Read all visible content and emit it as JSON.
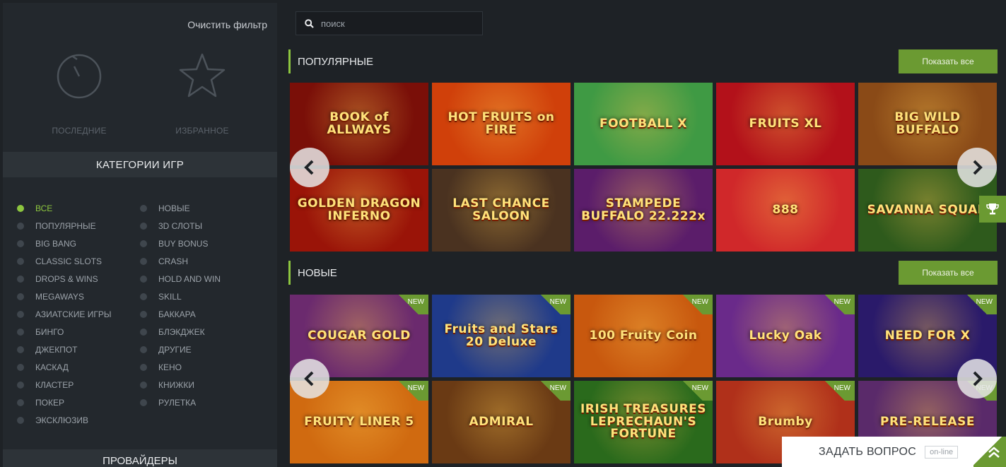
{
  "sidebar": {
    "clear_filter": "Очистить фильтр",
    "quick": {
      "recent": "ПОСЛЕДНИЕ",
      "favorites": "ИЗБРАННОЕ"
    },
    "categories_title": "КАТЕГОРИИ ИГР",
    "categories_left": [
      "ВСЕ",
      "ПОПУЛЯРНЫЕ",
      "BIG BANG",
      "CLASSIC SLOTS",
      "DROPS & WINS",
      "MEGAWAYS",
      "АЗИАТСКИЕ ИГРЫ",
      "БИНГО",
      "ДЖЕКПОТ",
      "КАСКАД",
      "КЛАСТЕР",
      "ПОКЕР",
      "ЭКСКЛЮЗИВ"
    ],
    "categories_right": [
      "НОВЫЕ",
      "3D СЛОТЫ",
      "BUY BONUS",
      "CRASH",
      "HOLD AND WIN",
      "SKILL",
      "БАККАРА",
      "БЛЭКДЖЕК",
      "ДРУГИЕ",
      "КЕНО",
      "КНИЖКИ",
      "РУЛЕТКА"
    ],
    "active_category": "ВСЕ",
    "providers_title": "ПРОВАЙДЕРЫ"
  },
  "search": {
    "placeholder": "поиск"
  },
  "popular": {
    "title": "ПОПУЛЯРНЫЕ",
    "show_all": "Показать все",
    "games": [
      {
        "name": "BOOK of ALLWAYS",
        "bg": "#7a0f08"
      },
      {
        "name": "HOT FRUITS on FIRE",
        "bg": "#d0400a"
      },
      {
        "name": "FOOTBALL X",
        "bg": "#3f9a44"
      },
      {
        "name": "FRUITS XL",
        "bg": "#b3111a"
      },
      {
        "name": "BIG WILD BUFFALO",
        "bg": "#8a4a17"
      },
      {
        "name": "GOLDEN DRAGON INFERNO",
        "bg": "#9a1408"
      },
      {
        "name": "LAST CHANCE SALOON",
        "bg": "#4a3220"
      },
      {
        "name": "STAMPEDE BUFFALO 22.222x",
        "bg": "#5b1d6a"
      },
      {
        "name": "888",
        "bg": "#d0282a"
      },
      {
        "name": "SAVANNA SQUAD",
        "bg": "#2e5a1c"
      }
    ]
  },
  "new": {
    "title": "НОВЫЕ",
    "show_all": "Показать все",
    "badge": "NEW",
    "games": [
      {
        "name": "COUGAR GOLD",
        "bg": "#6b2a6e"
      },
      {
        "name": "Fruits and Stars 20 Deluxe",
        "bg": "#1f3a8a"
      },
      {
        "name": "100 Fruity Coin",
        "bg": "#c8580e"
      },
      {
        "name": "Lucky Oak",
        "bg": "#6a2a8a"
      },
      {
        "name": "NEED FOR X",
        "bg": "#2a1a6a"
      },
      {
        "name": "FRUITY LINER 5",
        "bg": "#d06a10"
      },
      {
        "name": "ADMIRAL",
        "bg": "#6a3a14"
      },
      {
        "name": "IRISH TREASURES LEPRECHAUN'S FORTUNE",
        "bg": "#2a6a1c"
      },
      {
        "name": "Brumby",
        "bg": "#b0301a"
      },
      {
        "name": "PRE-RELEASE",
        "bg": "#5a2a6a"
      }
    ]
  },
  "ask": {
    "label": "ЗАДАТЬ ВОПРОС",
    "status": "on-line"
  },
  "colors": {
    "accent": "#8dc63f",
    "button": "#6b9a32",
    "sidebar": "#23282d",
    "bg": "#1e2226"
  }
}
